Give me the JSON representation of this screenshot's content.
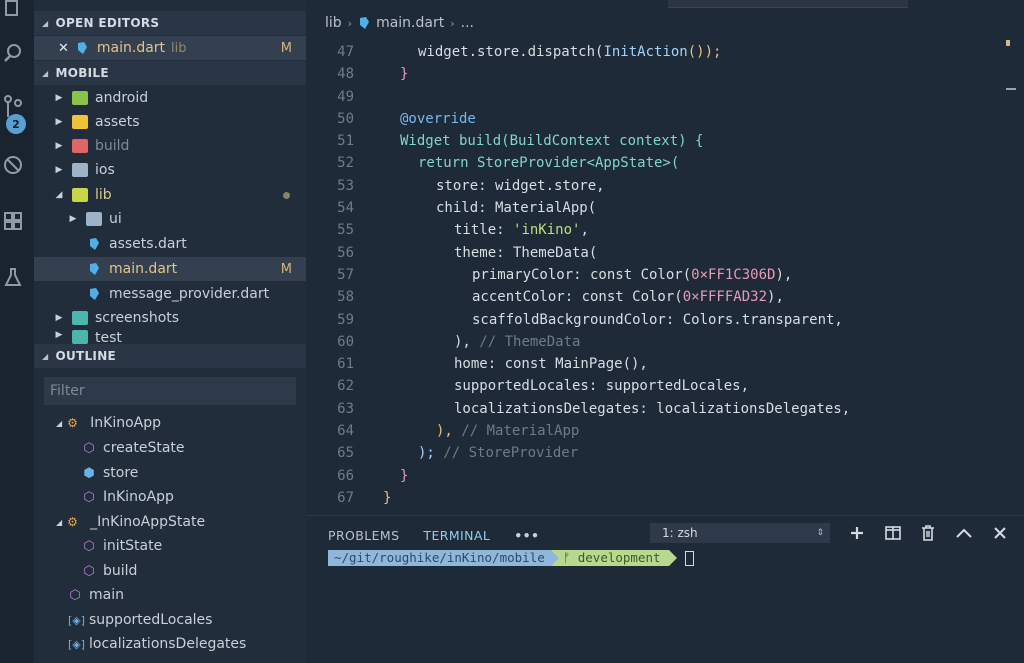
{
  "sidebar": {
    "open_editors_header": "OPEN EDITORS",
    "open_editor": {
      "name": "main.dart",
      "folder": "lib",
      "status": "M"
    },
    "mobile_header": "MOBILE",
    "tree": [
      {
        "label": "android",
        "kind": "folder",
        "color": "#8bc34a"
      },
      {
        "label": "assets",
        "kind": "folder",
        "color": "#f0c23b"
      },
      {
        "label": "build",
        "kind": "folder",
        "color": "#e06666",
        "dim": true
      },
      {
        "label": "ios",
        "kind": "folder",
        "color": "#9fb3c8"
      },
      {
        "label": "lib",
        "kind": "folder-open",
        "color": "#c8d64a"
      },
      {
        "label": "ui",
        "kind": "folder",
        "color": "#9fb3c8"
      },
      {
        "label": "assets.dart",
        "kind": "dart"
      },
      {
        "label": "main.dart",
        "kind": "dart",
        "status": "M"
      },
      {
        "label": "message_provider.dart",
        "kind": "dart"
      },
      {
        "label": "screenshots",
        "kind": "folder",
        "color": "#4db6ac"
      },
      {
        "label": "test",
        "kind": "folder",
        "color": "#4db6ac"
      }
    ],
    "outline_header": "OUTLINE",
    "filter_placeholder": "Filter",
    "outline": [
      {
        "label": "InKinoApp"
      },
      {
        "label": "createState"
      },
      {
        "label": "store"
      },
      {
        "label": "InKinoApp"
      },
      {
        "label": "_InKinoAppState"
      },
      {
        "label": "initState"
      },
      {
        "label": "build"
      },
      {
        "label": "main"
      },
      {
        "label": "supportedLocales"
      },
      {
        "label": "localizationsDelegates"
      }
    ]
  },
  "activity": {
    "scm_badge": "2"
  },
  "editor": {
    "breadcrumb": [
      "lib",
      "main.dart",
      "..."
    ],
    "lines": [
      {
        "num": "47",
        "a": "widget.store.dispatch(",
        "b": "InitAction",
        "c": "());"
      },
      {
        "num": "48",
        "a": "}"
      },
      {
        "num": "49",
        "a": ""
      },
      {
        "num": "50",
        "a": "@override"
      },
      {
        "num": "51",
        "a": "Widget build(BuildContext context) {"
      },
      {
        "num": "52",
        "a": "return StoreProvider<AppState>("
      },
      {
        "num": "53",
        "a": "store: widget.store,"
      },
      {
        "num": "54",
        "a": "child: MaterialApp("
      },
      {
        "num": "55",
        "a": "title: ",
        "b": "'inKino'",
        "c": ","
      },
      {
        "num": "56",
        "a": "theme: ThemeData("
      },
      {
        "num": "57",
        "a": "primaryColor: const Color(",
        "b": "0×FF1C306D",
        "c": "),"
      },
      {
        "num": "58",
        "a": "accentColor: const Color(",
        "b": "0×FFFFAD32",
        "c": "),"
      },
      {
        "num": "59",
        "a": "scaffoldBackgroundColor: Colors.transparent,"
      },
      {
        "num": "60",
        "a": "), ",
        "b": "// ThemeData"
      },
      {
        "num": "61",
        "a": "home: const MainPage(),"
      },
      {
        "num": "62",
        "a": "supportedLocales: supportedLocales,"
      },
      {
        "num": "63",
        "a": "localizationsDelegates: localizationsDelegates,"
      },
      {
        "num": "64",
        "a": "), ",
        "b": "// MaterialApp"
      },
      {
        "num": "65",
        "a": "); ",
        "b": "// StoreProvider"
      },
      {
        "num": "66",
        "a": "}"
      },
      {
        "num": "67",
        "a": "}"
      }
    ]
  },
  "panel": {
    "tabs": [
      "PROBLEMS",
      "TERMINAL"
    ],
    "more": "•••",
    "shell": "1: zsh",
    "prompt_path": "~/git/roughike/inKino/mobile",
    "prompt_branch": "ᚠ development"
  }
}
